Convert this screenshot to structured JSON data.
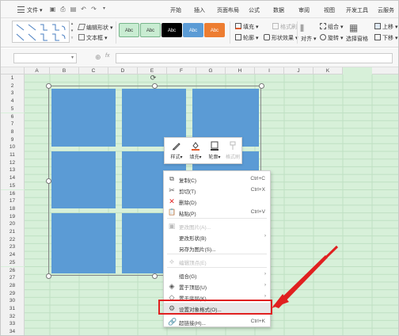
{
  "menubar": {
    "file_label": "文件",
    "tabs": [
      "开始",
      "插入",
      "页面布局",
      "公式",
      "数据",
      "审阅",
      "视图",
      "开发工具",
      "云服务"
    ]
  },
  "ribbon": {
    "edit_shape": "编辑形状",
    "textbox": "文本框",
    "style_buttons": [
      {
        "label": "Abc",
        "bg": "#c9ecd2",
        "fg": "#333333"
      },
      {
        "label": "Abc",
        "bg": "#c9ecd2",
        "fg": "#333333"
      },
      {
        "label": "Abc",
        "bg": "#000000",
        "fg": "#ffffff"
      },
      {
        "label": "Abc",
        "bg": "#5b9bd5",
        "fg": "#ffffff"
      },
      {
        "label": "Abc",
        "bg": "#ed7d31",
        "fg": "#ffffff"
      }
    ],
    "fill": "填充",
    "format_painter": "格式刷",
    "outline": "轮廓",
    "shape_effect": "形状效果",
    "align": "对齐",
    "group": "组合",
    "rotate": "旋转",
    "select_pane": "选择窗格",
    "bring_forward": "上移",
    "send_backward": "下移"
  },
  "colors": {
    "shape_fill": "#5b9bd5",
    "sheet_bg": "#d7f0d9",
    "highlight": "#e02020"
  },
  "sheet": {
    "columns": [
      "A",
      "B",
      "C",
      "D",
      "E",
      "F",
      "G",
      "H",
      "I",
      "J",
      "K"
    ],
    "rows": [
      "1",
      "2",
      "3",
      "4",
      "5",
      "6",
      "7",
      "8",
      "9",
      "10",
      "11",
      "12",
      "13",
      "14",
      "15",
      "16",
      "17",
      "18",
      "19",
      "20",
      "21",
      "22",
      "23",
      "24",
      "25",
      "26",
      "27",
      "28",
      "29",
      "30",
      "31",
      "32",
      "33",
      "34"
    ]
  },
  "mini_toolbar": [
    {
      "label": "样式",
      "icon": "brush-icon",
      "disabled": false
    },
    {
      "label": "填充",
      "icon": "fill-icon",
      "disabled": false
    },
    {
      "label": "轮廓",
      "icon": "outline-icon",
      "disabled": false
    },
    {
      "label": "格式刷",
      "icon": "format-painter-icon",
      "disabled": true
    }
  ],
  "context_menu": [
    {
      "label": "复制(C)",
      "shortcut": "Ctrl+C",
      "icon": "copy-icon",
      "disabled": false
    },
    {
      "label": "剪切(T)",
      "shortcut": "Ctrl+X",
      "icon": "scissors-icon",
      "disabled": false
    },
    {
      "label": "删除(D)",
      "shortcut": "",
      "icon": "delete-icon",
      "disabled": false
    },
    {
      "label": "粘贴(P)",
      "shortcut": "Ctrl+V",
      "icon": "paste-icon",
      "disabled": false
    },
    {
      "label": "更改图片(A)...",
      "shortcut": "",
      "icon": "change-picture-icon",
      "disabled": true
    },
    {
      "label": "更改形状(B)",
      "shortcut": "",
      "icon": "",
      "disabled": false,
      "submenu": true
    },
    {
      "label": "另存为图片(S)...",
      "shortcut": "",
      "icon": "",
      "disabled": false
    },
    {
      "label": "编辑顶点(E)",
      "shortcut": "",
      "icon": "edit-points-icon",
      "disabled": true
    },
    {
      "label": "组合(G)",
      "shortcut": "",
      "icon": "",
      "disabled": false,
      "submenu": true
    },
    {
      "label": "置于顶层(U)",
      "shortcut": "",
      "icon": "bring-to-front-icon",
      "disabled": false,
      "submenu": true
    },
    {
      "label": "置于底层(K)",
      "shortcut": "",
      "icon": "send-to-back-icon",
      "disabled": false,
      "submenu": true
    },
    {
      "label": "设置对象格式(O)...",
      "shortcut": "",
      "icon": "format-object-icon",
      "disabled": false,
      "hover": true
    },
    {
      "label": "超链接(H)...",
      "shortcut": "Ctrl+K",
      "icon": "hyperlink-icon",
      "disabled": false
    }
  ]
}
